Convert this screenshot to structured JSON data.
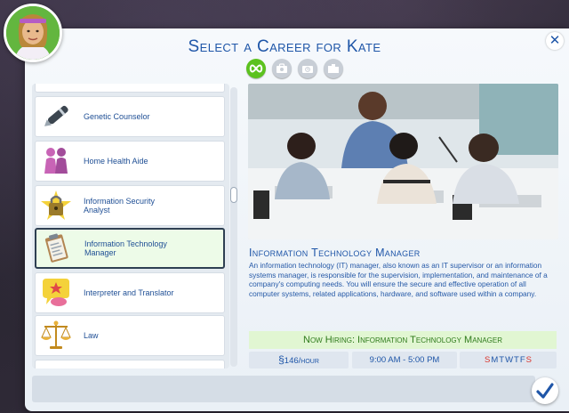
{
  "dialog": {
    "title": "Select a Career for Kate",
    "close_symbol": "✕",
    "confirm_icon": "checkmark-icon"
  },
  "filters": [
    {
      "icon": "infinity-icon",
      "active": true
    },
    {
      "icon": "career-case-icon",
      "active": false
    },
    {
      "icon": "part-time-clock-icon",
      "active": false
    },
    {
      "icon": "freelance-folder-icon",
      "active": false
    }
  ],
  "careers": [
    {
      "label": "Genetic Counselor",
      "icon": "pen-icon"
    },
    {
      "label": "Home Health Aide",
      "icon": "people-icon"
    },
    {
      "label": "Information Security Analyst",
      "icon": "padlock-icon"
    },
    {
      "label": "Information Technology Manager",
      "icon": "clipboard-icon",
      "selected": true
    },
    {
      "label": "Interpreter and Translator",
      "icon": "speech-star-icon"
    },
    {
      "label": "Law",
      "icon": "scales-icon"
    }
  ],
  "detail": {
    "name": "Information Technology Manager",
    "description": "An information technology (IT) manager, also known as an IT supervisor or an information systems manager, is responsible for the supervision, implementation, and maintenance of a company's computing needs. You will ensure the secure and effective operation of all computer systems, related applications, hardware, and software used within a company.",
    "hiring": "Now Hiring: Information Technology Manager",
    "pay_symbol": "§",
    "pay": "146/hour",
    "hours": "9:00 AM - 5:00 PM",
    "days": [
      {
        "d": "S",
        "work": false
      },
      {
        "d": "M",
        "work": true
      },
      {
        "d": "T",
        "work": true
      },
      {
        "d": "W",
        "work": true
      },
      {
        "d": "T",
        "work": true
      },
      {
        "d": "F",
        "work": true
      },
      {
        "d": "S",
        "work": false
      }
    ]
  },
  "colors": {
    "accent": "#1f56a8",
    "hiring_text": "#2f7b1c",
    "selected_border": "#2e3f52",
    "filter_active": "#5cc21f"
  }
}
